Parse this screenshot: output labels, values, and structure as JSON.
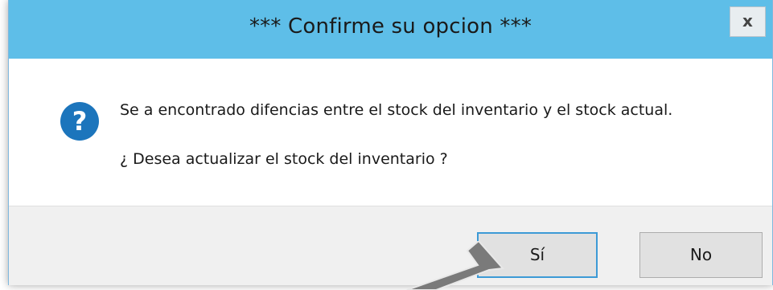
{
  "dialog": {
    "title": "*** Confirme su opcion ***",
    "close_symbol": "x",
    "icon": "question-icon",
    "icon_glyph": "?",
    "message_line1": "Se a encontrado difencias entre el stock del inventario y el stock actual.",
    "message_line2": "¿ Desea actualizar el stock del inventario ?",
    "buttons": {
      "yes_label": "Sí",
      "no_label": "No"
    }
  },
  "colors": {
    "titlebar": "#5ebee8",
    "icon_blue": "#1c75bc",
    "default_button_border": "#3c9ad6",
    "footer": "#f0f0f0",
    "pointer_arrow": "#7a7a7a"
  }
}
